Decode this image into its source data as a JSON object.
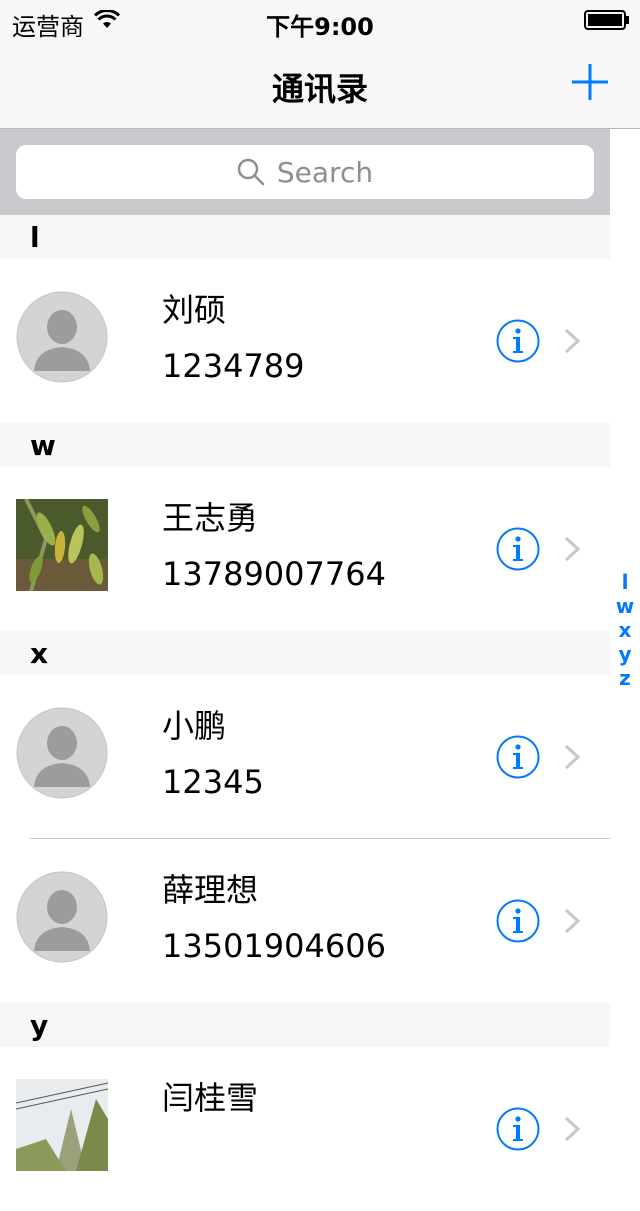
{
  "status_bar": {
    "carrier": "运营商",
    "time": "下午9:00"
  },
  "nav": {
    "title": "通讯录",
    "add_icon": "plus-icon"
  },
  "search": {
    "placeholder": "Search"
  },
  "colors": {
    "accent": "#007aff",
    "section_bg": "#f7f7f7",
    "search_bg": "#c9c9ce"
  },
  "sections": [
    {
      "letter": "l",
      "contacts": [
        {
          "name": "刘硕",
          "phone": "1234789",
          "avatar": "default"
        }
      ]
    },
    {
      "letter": "w",
      "contacts": [
        {
          "name": "王志勇",
          "phone": "13789007764",
          "avatar": "photo-leaves"
        }
      ]
    },
    {
      "letter": "x",
      "contacts": [
        {
          "name": "小鹏",
          "phone": "12345",
          "avatar": "default"
        },
        {
          "name": "薛理想",
          "phone": "13501904606",
          "avatar": "default"
        }
      ]
    },
    {
      "letter": "y",
      "contacts": [
        {
          "name": "闫桂雪",
          "phone": "",
          "avatar": "photo-landscape"
        }
      ]
    }
  ],
  "index": [
    "l",
    "w",
    "x",
    "y",
    "z"
  ]
}
